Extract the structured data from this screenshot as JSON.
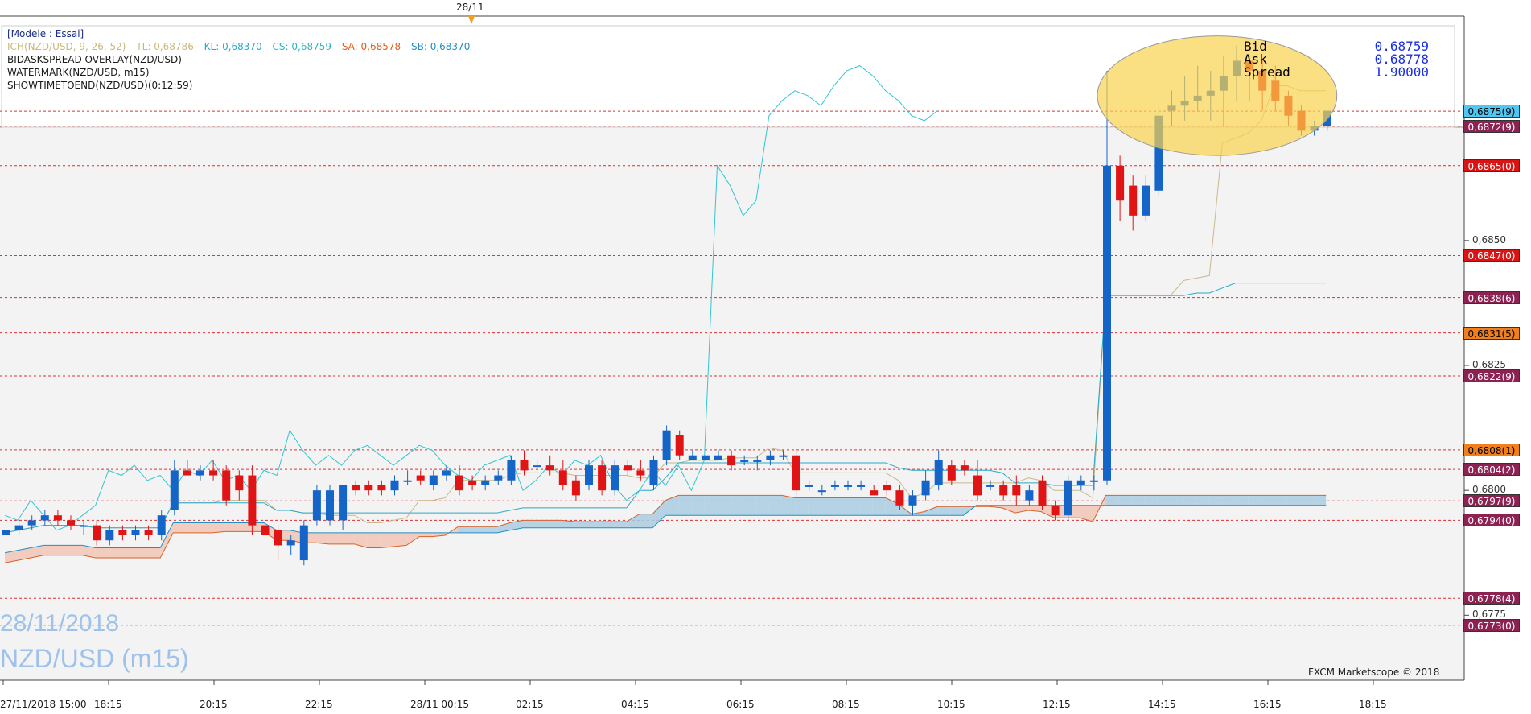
{
  "header": {
    "model": "[Modele : Essai]",
    "ichimoku": {
      "name": "ICH(NZD/USD, 9, 26, 52)",
      "tl": "TL: 0,68786",
      "kl": "KL: 0,68370",
      "cs": "CS: 0,68759",
      "sa": "SA: 0,68578",
      "sb": "SB: 0,68370"
    },
    "line2": "BIDASKSPREAD OVERLAY(NZD/USD)",
    "line3": "WATERMARK(NZD/USD, m15)",
    "line4": "SHOWTIMETOEND(NZD/USD)(0:12:59)"
  },
  "bidask": {
    "bid_label": "Bid",
    "bid": "0.68759",
    "ask_label": "Ask",
    "ask": "0.68778",
    "spread_label": "Spread",
    "spread": "1.90000"
  },
  "watermark": {
    "date": "28/11/2018",
    "symbol": "NZD/USD (m15)"
  },
  "copyright": "FXCM Marketscope © 2018",
  "date_flag": "28/11",
  "colors": {
    "bull": "#1565c8",
    "bear": "#e01414",
    "tenkan": "#c9b98a",
    "kijun": "#2aa9c9",
    "chikou": "#31c5d2",
    "kumo_up": "#a9cde0",
    "kumo_down": "#f2c4b6",
    "highlight": "#f9d24f"
  },
  "price_labels": [
    {
      "text": "0,6875(9)",
      "style": "blue"
    },
    {
      "text": "0,6872(9)",
      "style": "dark"
    },
    {
      "text": "0,6865(0)",
      "style": "red"
    },
    {
      "text": "0,6847(0)",
      "style": "red"
    },
    {
      "text": "0,6838(6)",
      "style": "dark"
    },
    {
      "text": "0,6831(5)",
      "style": "orange"
    },
    {
      "text": "0,6822(9)",
      "style": "dark"
    },
    {
      "text": "0,6808(1)",
      "style": "orange"
    },
    {
      "text": "0,6804(2)",
      "style": "dark"
    },
    {
      "text": "0,6797(9)",
      "style": "dark"
    },
    {
      "text": "0,6794(0)",
      "style": "dark"
    },
    {
      "text": "0,6778(4)",
      "style": "dark"
    },
    {
      "text": "0,6773(0)",
      "style": "dark"
    }
  ],
  "chart_data": {
    "type": "candlestick",
    "symbol": "NZD/USD",
    "timeframe": "m15",
    "ylim": [
      0.6762,
      0.6893
    ],
    "y_ticks": [
      "0,6850",
      "0,6825",
      "0,6800",
      "0,6775"
    ],
    "y_tick_values": [
      0.685,
      0.6825,
      0.68,
      0.6775
    ],
    "x_ticks": [
      "27/11/2018 15:00",
      "18:15",
      "20:15",
      "22:15",
      "28/11 00:15",
      "02:15",
      "04:15",
      "06:15",
      "08:15",
      "10:15",
      "12:15",
      "14:15",
      "16:15",
      "18:15"
    ],
    "horizontal_levels": [
      0.68759,
      0.68729,
      0.6865,
      0.6847,
      0.68386,
      0.68315,
      0.68229,
      0.68081,
      0.68042,
      0.67979,
      0.6794,
      0.67784,
      0.6773
    ],
    "ohlc": [
      [
        0.6791,
        0.6793,
        0.679,
        0.6792
      ],
      [
        0.6792,
        0.6794,
        0.6791,
        0.6793
      ],
      [
        0.6793,
        0.6795,
        0.6792,
        0.6794
      ],
      [
        0.6794,
        0.6796,
        0.6793,
        0.6795
      ],
      [
        0.6795,
        0.6796,
        0.6793,
        0.6794
      ],
      [
        0.6794,
        0.6795,
        0.6792,
        0.6793
      ],
      [
        0.6793,
        0.6794,
        0.6791,
        0.6793
      ],
      [
        0.6793,
        0.6794,
        0.6789,
        0.679
      ],
      [
        0.679,
        0.6793,
        0.6789,
        0.6792
      ],
      [
        0.6792,
        0.6793,
        0.679,
        0.6791
      ],
      [
        0.6791,
        0.6793,
        0.679,
        0.6792
      ],
      [
        0.6792,
        0.6793,
        0.679,
        0.6791
      ],
      [
        0.6791,
        0.6796,
        0.679,
        0.6795
      ],
      [
        0.6796,
        0.6806,
        0.6795,
        0.6804
      ],
      [
        0.6804,
        0.6806,
        0.6803,
        0.6803
      ],
      [
        0.6803,
        0.6805,
        0.6802,
        0.6804
      ],
      [
        0.6804,
        0.6806,
        0.6802,
        0.6803
      ],
      [
        0.6804,
        0.6805,
        0.6797,
        0.6798
      ],
      [
        0.6803,
        0.6804,
        0.6798,
        0.68
      ],
      [
        0.6803,
        0.6805,
        0.6791,
        0.6793
      ],
      [
        0.6793,
        0.6795,
        0.679,
        0.6791
      ],
      [
        0.6792,
        0.6793,
        0.6786,
        0.6789
      ],
      [
        0.6789,
        0.6791,
        0.6787,
        0.679
      ],
      [
        0.6786,
        0.6794,
        0.6785,
        0.6793
      ],
      [
        0.6794,
        0.6801,
        0.6793,
        0.68
      ],
      [
        0.6794,
        0.6801,
        0.6793,
        0.68
      ],
      [
        0.6794,
        0.6801,
        0.6792,
        0.6801
      ],
      [
        0.6801,
        0.6802,
        0.6799,
        0.68
      ],
      [
        0.6801,
        0.6802,
        0.6799,
        0.68
      ],
      [
        0.6801,
        0.6802,
        0.6799,
        0.68
      ],
      [
        0.68,
        0.6803,
        0.6799,
        0.6802
      ],
      [
        0.6802,
        0.6804,
        0.6801,
        0.6802
      ],
      [
        0.6803,
        0.6804,
        0.6801,
        0.6802
      ],
      [
        0.6801,
        0.6804,
        0.68,
        0.6803
      ],
      [
        0.6803,
        0.6805,
        0.6802,
        0.6804
      ],
      [
        0.6803,
        0.6805,
        0.6799,
        0.68
      ],
      [
        0.6802,
        0.6803,
        0.68,
        0.6801
      ],
      [
        0.6801,
        0.6803,
        0.68,
        0.6802
      ],
      [
        0.6802,
        0.6804,
        0.6801,
        0.6803
      ],
      [
        0.6802,
        0.6807,
        0.6801,
        0.6806
      ],
      [
        0.6806,
        0.6808,
        0.6803,
        0.6804
      ],
      [
        0.6805,
        0.6806,
        0.6804,
        0.6805
      ],
      [
        0.6805,
        0.6807,
        0.6803,
        0.6804
      ],
      [
        0.6804,
        0.6806,
        0.68,
        0.6801
      ],
      [
        0.6802,
        0.6803,
        0.6798,
        0.6799
      ],
      [
        0.6801,
        0.6806,
        0.68,
        0.6805
      ],
      [
        0.6805,
        0.6806,
        0.6799,
        0.68
      ],
      [
        0.68,
        0.6806,
        0.6799,
        0.6805
      ],
      [
        0.6805,
        0.6806,
        0.6803,
        0.6804
      ],
      [
        0.6804,
        0.6806,
        0.6802,
        0.6803
      ],
      [
        0.6801,
        0.6807,
        0.68,
        0.6806
      ],
      [
        0.6806,
        0.6813,
        0.6805,
        0.6812
      ],
      [
        0.6811,
        0.6812,
        0.6806,
        0.6807
      ],
      [
        0.6806,
        0.6808,
        0.6806,
        0.6807
      ],
      [
        0.6806,
        0.6807,
        0.6806,
        0.6807
      ],
      [
        0.6806,
        0.6808,
        0.6806,
        0.6807
      ],
      [
        0.6807,
        0.6808,
        0.6804,
        0.6805
      ],
      [
        0.6806,
        0.6807,
        0.6805,
        0.6806
      ],
      [
        0.6806,
        0.6807,
        0.6804,
        0.6806
      ],
      [
        0.6806,
        0.6808,
        0.6805,
        0.6807
      ],
      [
        0.6807,
        0.6808,
        0.6806,
        0.6807
      ],
      [
        0.6807,
        0.6808,
        0.6799,
        0.68
      ],
      [
        0.6801,
        0.6802,
        0.68,
        0.6801
      ],
      [
        0.68,
        0.6801,
        0.6799,
        0.68
      ],
      [
        0.6801,
        0.6802,
        0.68,
        0.6801
      ],
      [
        0.6801,
        0.6802,
        0.68,
        0.6801
      ],
      [
        0.6801,
        0.6802,
        0.68,
        0.6801
      ],
      [
        0.68,
        0.6801,
        0.6799,
        0.6799
      ],
      [
        0.6801,
        0.6802,
        0.6799,
        0.68
      ],
      [
        0.68,
        0.6801,
        0.6796,
        0.6797
      ],
      [
        0.6797,
        0.68,
        0.6795,
        0.6799
      ],
      [
        0.6799,
        0.6804,
        0.6798,
        0.6802
      ],
      [
        0.6801,
        0.6808,
        0.68,
        0.6806
      ],
      [
        0.6805,
        0.6806,
        0.6801,
        0.6802
      ],
      [
        0.6805,
        0.6806,
        0.6803,
        0.6804
      ],
      [
        0.6803,
        0.6806,
        0.6798,
        0.6799
      ],
      [
        0.6801,
        0.6802,
        0.68,
        0.6801
      ],
      [
        0.6801,
        0.6802,
        0.6798,
        0.6799
      ],
      [
        0.6801,
        0.6803,
        0.6797,
        0.6799
      ],
      [
        0.6798,
        0.6801,
        0.6797,
        0.68
      ],
      [
        0.6802,
        0.6803,
        0.6796,
        0.6797
      ],
      [
        0.6797,
        0.6798,
        0.6794,
        0.6795
      ],
      [
        0.6795,
        0.6803,
        0.6794,
        0.6802
      ],
      [
        0.6801,
        0.6803,
        0.68,
        0.6802
      ],
      [
        0.6802,
        0.6803,
        0.68,
        0.6802
      ],
      [
        0.6802,
        0.6884,
        0.6801,
        0.6865
      ],
      [
        0.6865,
        0.6867,
        0.6854,
        0.6858
      ],
      [
        0.6861,
        0.6863,
        0.6852,
        0.6855
      ],
      [
        0.6855,
        0.6863,
        0.6854,
        0.6861
      ],
      [
        0.686,
        0.6877,
        0.6859,
        0.6875
      ],
      [
        0.6876,
        0.688,
        0.6873,
        0.6877
      ],
      [
        0.6877,
        0.6883,
        0.6874,
        0.6878
      ],
      [
        0.6878,
        0.6885,
        0.6876,
        0.6879
      ],
      [
        0.6879,
        0.6884,
        0.6874,
        0.688
      ],
      [
        0.688,
        0.6887,
        0.6873,
        0.6883
      ],
      [
        0.6883,
        0.6889,
        0.6878,
        0.6886
      ],
      [
        0.6886,
        0.6887,
        0.6878,
        0.6884
      ],
      [
        0.6884,
        0.6886,
        0.6876,
        0.688
      ],
      [
        0.6882,
        0.6885,
        0.6876,
        0.6878
      ],
      [
        0.6879,
        0.688,
        0.6873,
        0.6875
      ],
      [
        0.6876,
        0.6877,
        0.6871,
        0.6872
      ],
      [
        0.6872,
        0.6874,
        0.6871,
        0.6873
      ],
      [
        0.6873,
        0.6876,
        0.6872,
        0.6876
      ]
    ],
    "chikou": [
      0.6795,
      0.6794,
      0.6798,
      0.6795,
      0.6792,
      0.6793,
      0.6795,
      0.6797,
      0.6804,
      0.6803,
      0.6805,
      0.6802,
      0.6803,
      0.68,
      0.6804,
      0.6803,
      0.6806,
      0.6802,
      0.6803,
      0.68,
      0.6804,
      0.6803,
      0.6812,
      0.6808,
      0.6805,
      0.6807,
      0.6805,
      0.6808,
      0.6809,
      0.6807,
      0.6805,
      0.6807,
      0.6809,
      0.6808,
      0.6805,
      0.6803,
      0.6802,
      0.6805,
      0.6806,
      0.6807,
      0.68,
      0.6802,
      0.6805,
      0.6803,
      0.6806,
      0.6805,
      0.6807,
      0.6801,
      0.6798,
      0.68,
      0.6804,
      0.6801,
      0.6805,
      0.68,
      0.6806,
      0.6865,
      0.6861,
      0.6855,
      0.6858,
      0.6875,
      0.6878,
      0.688,
      0.6879,
      0.6877,
      0.6881,
      0.6884,
      0.6885,
      0.6883,
      0.688,
      0.6878,
      0.6875,
      0.6874,
      0.6876
    ]
  }
}
